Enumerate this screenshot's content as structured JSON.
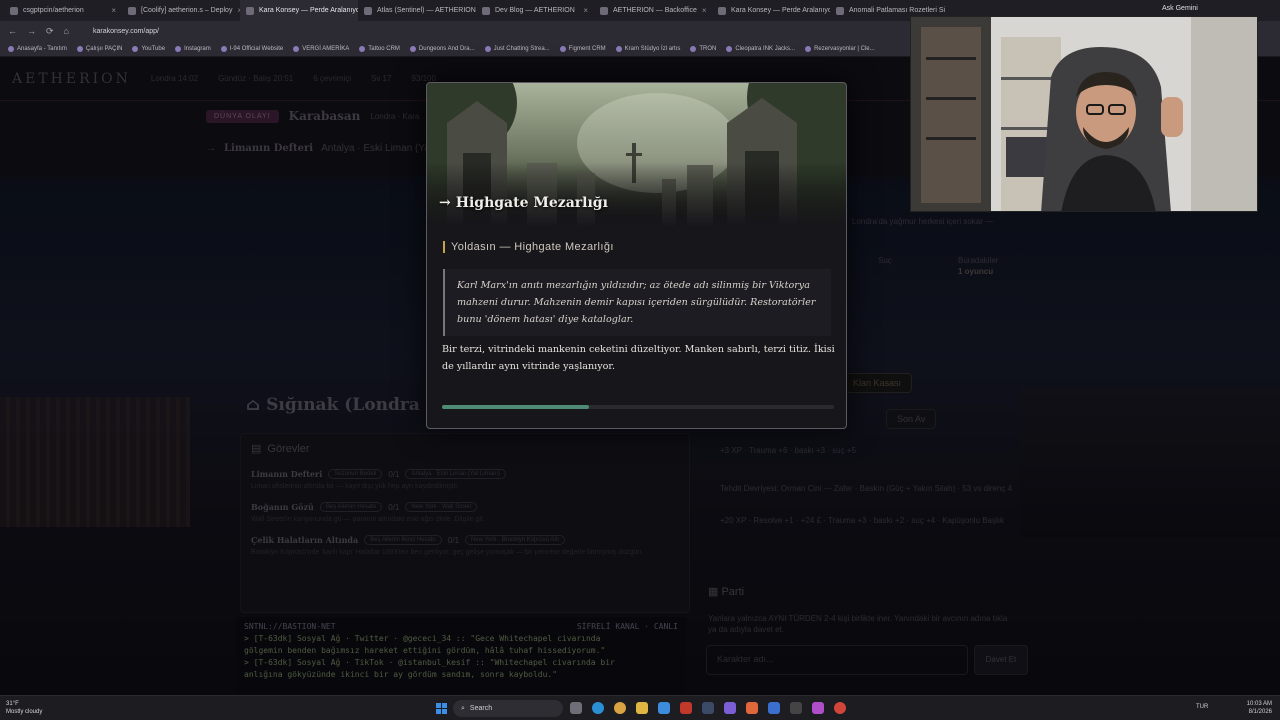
{
  "browser": {
    "tabs": [
      {
        "label": "csgptpcin/aetherion",
        "active": false
      },
      {
        "label": "[Coolify] aetherion.s – Deploy",
        "active": false
      },
      {
        "label": "Kara Konsey — Perde Aralanıyo",
        "active": true
      },
      {
        "label": "Atlas (Sentinel) — AETHERION",
        "active": false
      },
      {
        "label": "Dev Blog — AETHERION",
        "active": false
      },
      {
        "label": "AETHERION — Backoffice",
        "active": false
      },
      {
        "label": "Kara Konsey — Perde Aralanıyo",
        "active": false
      },
      {
        "label": "Anomali Patlaması Rozetleri Si",
        "active": false
      }
    ],
    "url": "karakonsey.com/app/",
    "profile": "Ask Gemini",
    "bookmarks": [
      "Anasayfa - Tanıtım",
      "Çalışıı PAÇIN",
      "YouTube",
      "Instagram",
      "I-94 Official Website",
      "VERGİ AMERİKA",
      "Tattoo CRM",
      "Dungeons And Dra...",
      "Just Chatting Strea...",
      "Figment CRM",
      "Kram Stüdyo İzl artıs",
      "TRON",
      "Cleopatra INK Jacks...",
      "Rezervasyonlar | Cle..."
    ]
  },
  "page": {
    "brand": "AETHERION",
    "nav_stats": [
      "Londra 14:02",
      "Gündüz · Balış 20:51",
      "6 çevrimiçi",
      "Sv 17",
      "93/100"
    ],
    "event_badge": "DÜNYA OLAYI",
    "event_title": "Karabasan",
    "event_sub": "Londra · Kara",
    "quest_banner_title": "Limanın Defteri",
    "quest_banner_sub": "Antalya · Eski Liman (Ya",
    "shelter_title": "Sığınak (Londra",
    "tasks_header": "Görevler",
    "tasks": [
      {
        "title": "Limanın Defteri",
        "chip": "Sezonun Bedeli",
        "count": "0/1",
        "loc": "Antalya · Eski Liman (Yat Limanı)",
        "desc": "Liman ofislerinin altında bir — kayıt dışı yük hep ayrı kaydedilmiştir."
      },
      {
        "title": "Boğanın Gözü",
        "chip": "Beş Ailenin Hesabı",
        "count": "0/1",
        "loc": "New York · Wall Street",
        "desc": "Wall Street'in kanyonunda gü — paranın altındaki eski ağzı dinle. Dilgile git."
      },
      {
        "title": "Çelik Halatların Altında",
        "chip": "Beş Ailenin İkinci Hesabı",
        "count": "0/1",
        "loc": "New York · Brooklyn Köprüsü Altı",
        "desc": "Brooklyn Köprüsü'nde 'kanlı kapı' Halatlar 1883'ten beri geriliyor; geç gelişe yumuşak — bir pencere değerle bitmişmiş düzgün."
      }
    ],
    "terminal_header": "SNTNL://BASTION-NET",
    "terminal_status": "SİFRELİ KANAL · CANLI",
    "terminal_lines": [
      "> [T-63dk] Sosyal Ağ · Twitter · @gececi_34 :: \"Gece Whitechapel civarında",
      "gölgemin benden bağımsız hareket ettiğini gördüm, hâlâ tuhaf hissediyorum.\"",
      "> [T-63dk] Sosyal Ağ · TikTok · @istanbul_kesif :: \"Whitechapel civarında bir",
      "anlığına gökyüzünde ikinci bir ay gördüm sandım, sonra kayboldu.\""
    ],
    "right": {
      "rain_note": "Londra'da yağmur herkesi içeri sokar —",
      "suc_label": "Suç",
      "buradakiler_label": "Buradakiler",
      "buradakiler_value": "1 oyuncu",
      "clan_button": "Klan Kasası",
      "hunt_button": "Son Av",
      "xp_line": "+3 XP · Trauma +6 · baskı +3 · suç +5",
      "threat_line": "Tehdit Devriyesi: Orman Cini — Zafer · Baskın (Güç + Yakın Silah) · 53 vs direnç 4",
      "reward_line": "+20 XP · Resolve +1 · +24 £ · Trauma +3 · baskı +2 · suç +4 · Kapüşonlu Başlık",
      "party_header": "Parti",
      "party_desc": "Yanlara yalnızca AYNI TÜRDEN 2-4 kişi birlikte iner. Yanındaki bir avcının adına tıkla ya da adıyla davet et.",
      "party_placeholder": "Karakter adı...",
      "party_invite": "Davet Et"
    }
  },
  "modal": {
    "title_arrow": "→",
    "title": "Highgate Mezarlığı",
    "subtitle": "Yoldasın — Highgate Mezarlığı",
    "quote": "Karl Marx'ın anıtı mezarlığın yıldızıdır; az ötede adı silinmiş bir Viktorya mahzeni durur. Mahzenin demir kapısı içeriden sürgülüdür. Restoratörler bunu 'dönem hatası' diye kataloglar.",
    "text": "Bir terzi, vitrindeki mankenin ceketini düzeltiyor. Manken sabırlı, terzi titiz. İkisi de yıllardır aynı vitrinde yaşlanıyor.",
    "progress": 0.375
  },
  "taskbar": {
    "weather_temp": "31°F",
    "weather_desc": "Mostly cloudy",
    "search": "Search",
    "lang": "TUR",
    "time": "10:03 AM",
    "date": "8/1/2026"
  },
  "colors": {
    "accent_gold": "#c8a24a",
    "progress_green": "#4f8a74"
  }
}
